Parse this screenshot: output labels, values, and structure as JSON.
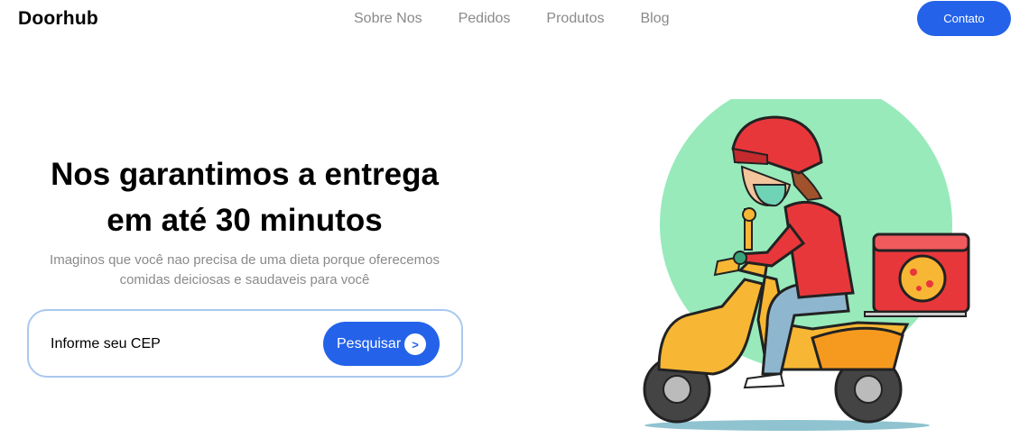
{
  "brand": "Doorhub",
  "nav": {
    "items": [
      "Sobre Nos",
      "Pedidos",
      "Produtos",
      "Blog"
    ],
    "cta": "Contato"
  },
  "hero": {
    "title_line1": "Nos garantimos a entrega",
    "title_line2": "em até 30 minutos",
    "subtitle_line1": "Imaginos que você nao precisa de uma dieta porque oferecemos",
    "subtitle_line2": "comidas deiciosas e saudaveis para você"
  },
  "search": {
    "placeholder": "Informe seu CEP",
    "button_label": "Pesquisar",
    "button_icon": ">"
  },
  "colors": {
    "accent": "#2462ea",
    "circle": "#98eabb",
    "scooter": "#f7b734",
    "helmet": "#e8373b"
  },
  "illustration": "delivery-rider-scooter-image"
}
